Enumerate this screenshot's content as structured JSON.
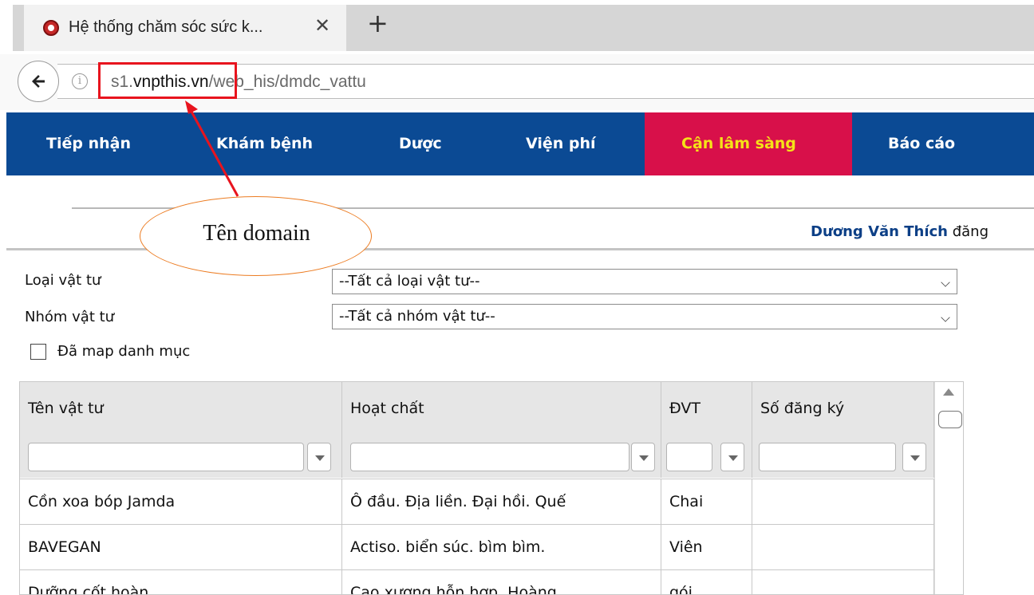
{
  "browser": {
    "tab_title": "Hệ thống chăm sóc sức k...",
    "close_glyph": "✕",
    "new_tab_glyph": "+",
    "url_host_prefix": "s1.",
    "url_host_domain": "vnpthis.vn",
    "url_path": "/web_his/dmdc_vattu"
  },
  "nav": {
    "items": [
      {
        "label": "Tiếp nhận"
      },
      {
        "label": "Khám bệnh"
      },
      {
        "label": "Dược"
      },
      {
        "label": "Viện phí"
      },
      {
        "label": "Cận lâm sàng",
        "active": true
      },
      {
        "label": "Báo cáo"
      }
    ]
  },
  "user": {
    "name": "Dương Văn Thích",
    "suffix": " đăng"
  },
  "filters": {
    "loai_label": "Loại vật tư",
    "loai_value": "--Tất cả loại vật tư--",
    "nhom_label": "Nhóm vật tư",
    "nhom_value": "--Tất cả nhóm vật tư--",
    "mapped_label": "Đã map danh mục",
    "mapped_checked": false
  },
  "table": {
    "columns": [
      "Tên vật tư",
      "Hoạt chất",
      "ĐVT",
      "Số đăng ký"
    ],
    "rows": [
      [
        "Cồn xoa bóp Jamda",
        "Ô đầu. Địa liền. Đại hồi. Quế",
        "Chai",
        ""
      ],
      [
        "BAVEGAN",
        "Actiso. biển súc. bìm bìm.",
        "Viên",
        ""
      ],
      [
        "Dưỡng cốt hoàn",
        "Cao xương hỗn hợp. Hoàng",
        "gói",
        ""
      ]
    ]
  },
  "annotation": {
    "label": "Tên domain",
    "colors": {
      "highlight": "#e8141e",
      "callout_border": "#ec7c22"
    }
  },
  "colors": {
    "nav_bg": "#0b4a94",
    "nav_active_bg": "#d8104a",
    "nav_active_text": "#f5e218"
  }
}
